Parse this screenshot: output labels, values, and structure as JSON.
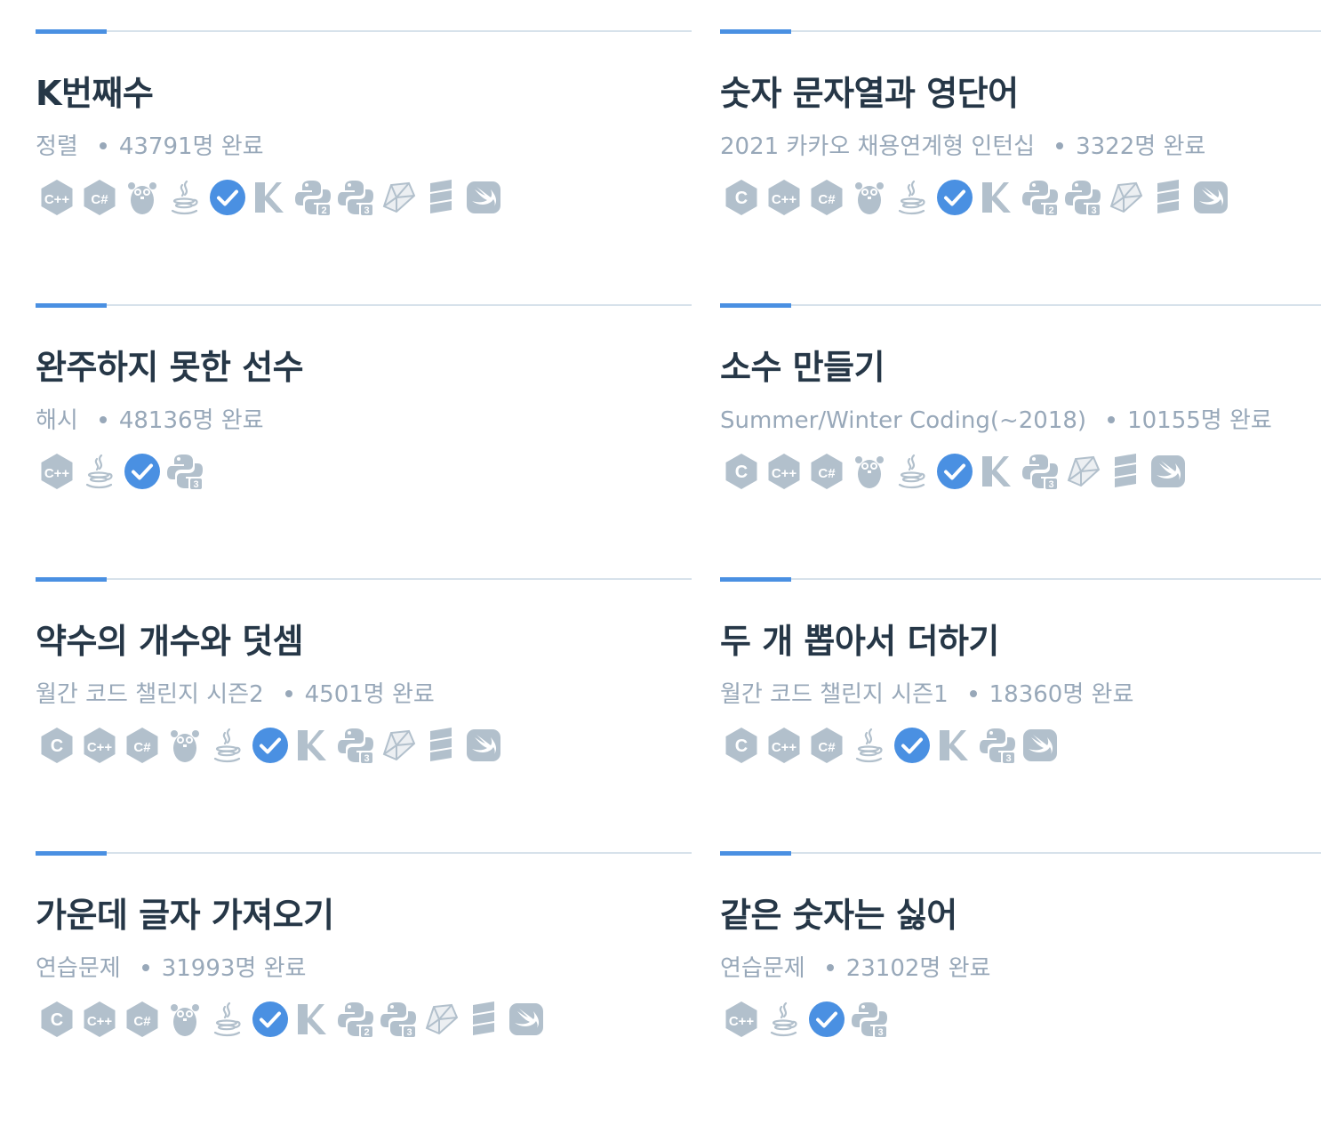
{
  "colors": {
    "accent": "#4a90e2",
    "title": "#263747",
    "meta": "#98a8b9",
    "icon": "#b2c0cc",
    "divider": "#d7e2eb"
  },
  "suffix": "완료",
  "cards": [
    {
      "title": "K번째수",
      "category": "정렬",
      "completed": "43791명 완료",
      "langs": [
        "cpp",
        "csharp",
        "go",
        "java",
        "javascript",
        "kotlin",
        "python2",
        "python3",
        "ruby",
        "scala",
        "swift"
      ]
    },
    {
      "title": "숫자 문자열과 영단어",
      "category": "2021 카카오 채용연계형 인턴십",
      "completed": "3322명 완료",
      "langs": [
        "c",
        "cpp",
        "csharp",
        "go",
        "java",
        "javascript",
        "kotlin",
        "python2",
        "python3",
        "ruby",
        "scala",
        "swift"
      ]
    },
    {
      "title": "완주하지 못한 선수",
      "category": "해시",
      "completed": "48136명 완료",
      "langs": [
        "cpp",
        "java",
        "javascript",
        "python3"
      ]
    },
    {
      "title": "소수 만들기",
      "category": "Summer/Winter Coding(~2018)",
      "completed": "10155명 완료",
      "langs": [
        "c",
        "cpp",
        "csharp",
        "go",
        "java",
        "javascript",
        "kotlin",
        "python3",
        "ruby",
        "scala",
        "swift"
      ]
    },
    {
      "title": "약수의 개수와 덧셈",
      "category": "월간 코드 챌린지 시즌2",
      "completed": "4501명 완료",
      "langs": [
        "c",
        "cpp",
        "csharp",
        "go",
        "java",
        "javascript",
        "kotlin",
        "python3",
        "ruby",
        "scala",
        "swift"
      ]
    },
    {
      "title": "두 개 뽑아서 더하기",
      "category": "월간 코드 챌린지 시즌1",
      "completed": "18360명 완료",
      "langs": [
        "c",
        "cpp",
        "csharp",
        "java",
        "javascript",
        "kotlin",
        "python3",
        "swift"
      ]
    },
    {
      "title": "가운데 글자 가져오기",
      "category": "연습문제",
      "completed": "31993명 완료",
      "langs": [
        "c",
        "cpp",
        "csharp",
        "go",
        "java",
        "javascript",
        "kotlin",
        "python2",
        "python3",
        "ruby",
        "scala",
        "swift"
      ]
    },
    {
      "title": "같은 숫자는 싫어",
      "category": "연습문제",
      "completed": "23102명 완료",
      "langs": [
        "cpp",
        "java",
        "javascript",
        "python3"
      ]
    }
  ]
}
